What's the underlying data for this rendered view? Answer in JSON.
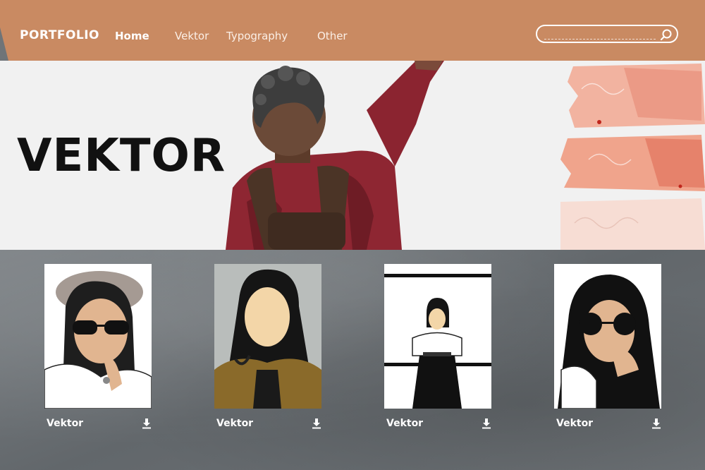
{
  "header": {
    "brand": "PORTFOLIO",
    "nav": [
      {
        "label": "Home",
        "active": true
      },
      {
        "label": "Vektor",
        "active": false
      },
      {
        "label": "Typography",
        "active": false
      },
      {
        "label": "Other",
        "active": false
      }
    ],
    "search": {
      "value": "",
      "placeholder": "",
      "icon": "search-icon"
    }
  },
  "hero": {
    "title": "VEKTOR"
  },
  "gallery": {
    "cards": [
      {
        "caption": "Vektor",
        "icon": "download-icon"
      },
      {
        "caption": "Vektor",
        "icon": "download-icon"
      },
      {
        "caption": "Vektor",
        "icon": "download-icon"
      },
      {
        "caption": "Vektor",
        "icon": "download-icon"
      }
    ]
  },
  "colors": {
    "navbar": "#c98a62",
    "hero_bg": "#f1f1f1",
    "gallery_bg": "#6f7478",
    "text_light": "#ffffff"
  }
}
